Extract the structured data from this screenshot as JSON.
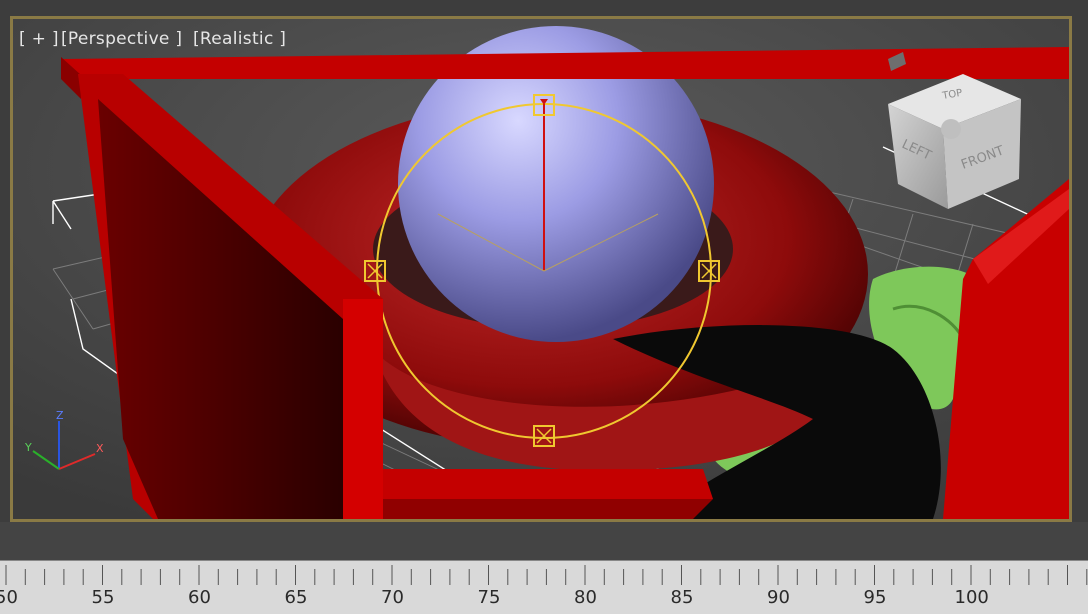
{
  "viewport": {
    "labels": {
      "plus": "[ + ]",
      "view": "[Perspective ]",
      "shading": "[Realistic ]"
    },
    "viewcube": {
      "top": "TOP",
      "left": "LEFT",
      "front": "FRONT"
    },
    "gizmo_axes": {
      "x": "X",
      "y": "Y",
      "z": "Z"
    },
    "colors": {
      "frame_border": "#8a7a45",
      "red_object": "#d40000",
      "sphere": "#9a9ae0",
      "torus": "#9e1010",
      "green_object": "#7ec85a",
      "selection_gizmo": "#f0c830"
    }
  },
  "timeline": {
    "labels": [
      "50",
      "55",
      "60",
      "65",
      "70",
      "75",
      "80",
      "85",
      "90",
      "95",
      "100"
    ]
  }
}
